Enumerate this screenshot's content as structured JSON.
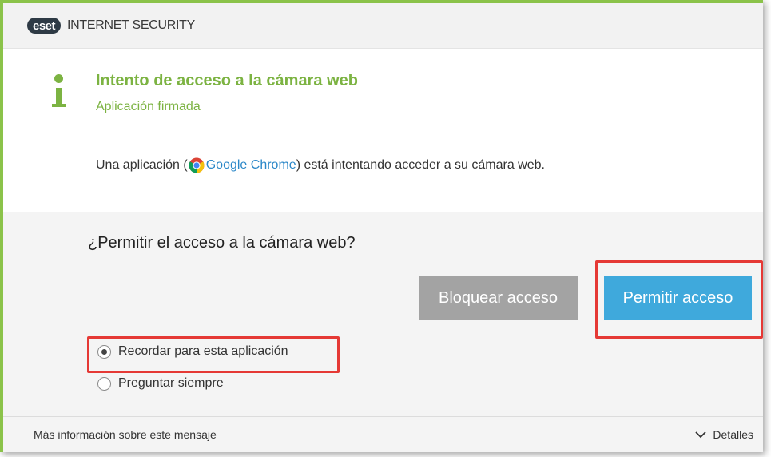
{
  "app": {
    "logo_text": "eset",
    "product_name": "INTERNET SECURITY",
    "accent_color": "#7cb342",
    "frame_color": "#8bc34a"
  },
  "alert": {
    "icon": "info-icon",
    "title": "Intento de acceso a la cámara web",
    "subtitle": "Aplicación firmada",
    "message_prefix": "Una aplicación (",
    "app_icon": "chrome-icon",
    "app_name": "Google Chrome",
    "message_suffix": " ) está intentando acceder a su cámara web."
  },
  "prompt": {
    "question": "¿Permitir el acceso a la cámara web?",
    "block_label": "Bloquear acceso",
    "allow_label": "Permitir acceso",
    "block_color": "#a3a3a3",
    "allow_color": "#3fa9dc",
    "options": [
      {
        "label": "Recordar para esta aplicación",
        "selected": true
      },
      {
        "label": "Preguntar siempre",
        "selected": false
      }
    ]
  },
  "footer": {
    "more_info": "Más información sobre este mensaje",
    "details_label": "Detalles",
    "details_icon": "chevron-down-icon"
  },
  "highlight_color": "#e53935"
}
